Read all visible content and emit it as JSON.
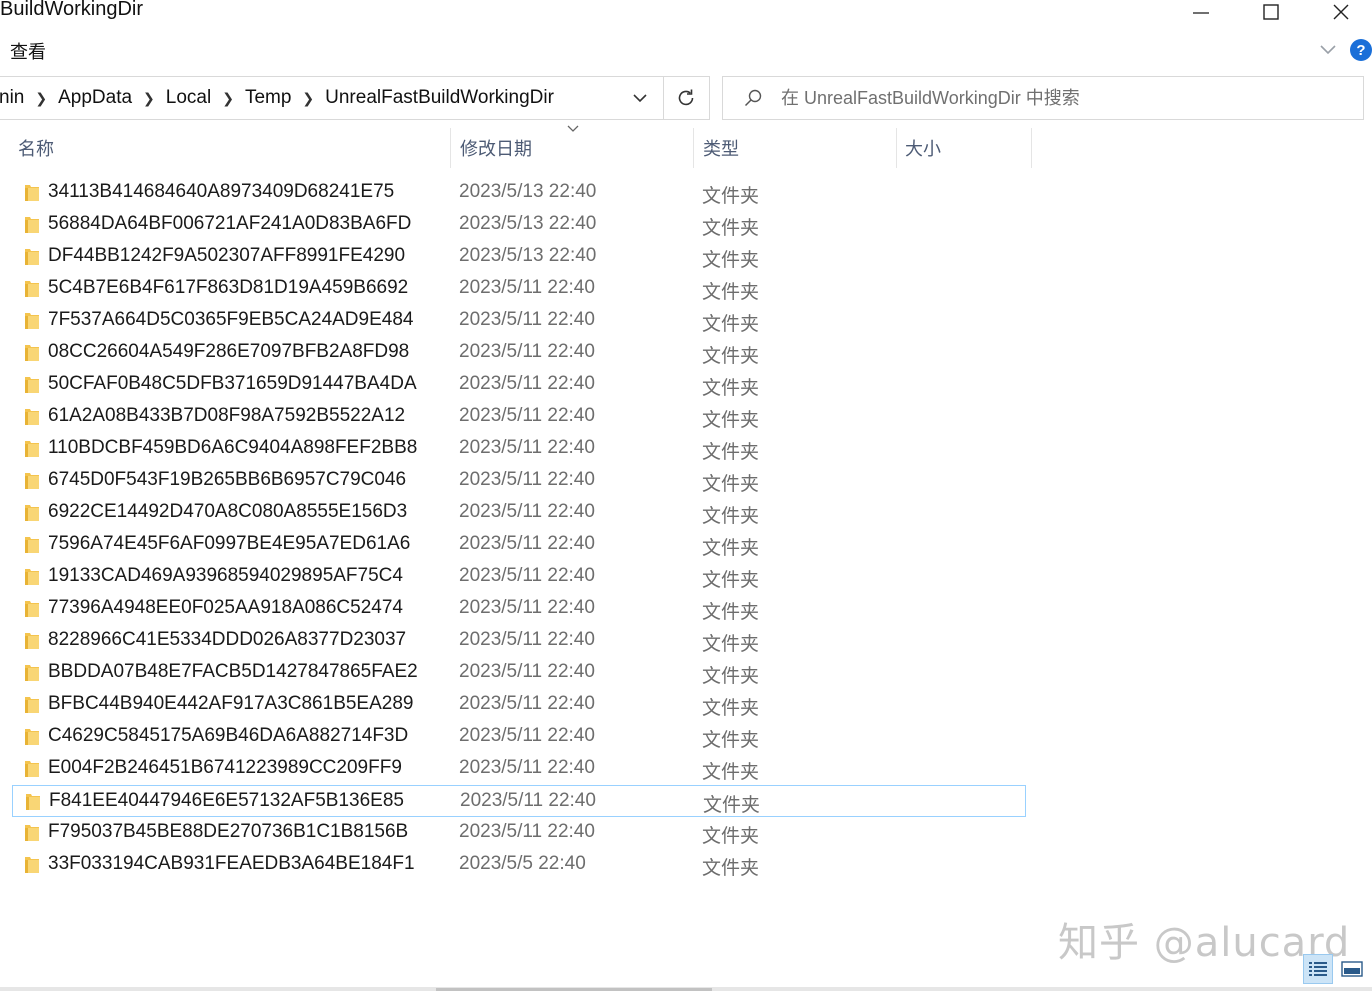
{
  "window": {
    "title": "BuildWorkingDir"
  },
  "ribbon": {
    "view_tab": "查看",
    "help_label": "?"
  },
  "address_bar": {
    "crumbs": [
      "nin",
      "AppData",
      "Local",
      "Temp",
      "UnrealFastBuildWorkingDir"
    ]
  },
  "search": {
    "placeholder": "在 UnrealFastBuildWorkingDir 中搜索"
  },
  "columns": {
    "name": "名称",
    "date": "修改日期",
    "type": "类型",
    "size": "大小"
  },
  "files": [
    {
      "name": "34113B414684640A8973409D68241E75",
      "date": "2023/5/13 22:40",
      "type": "文件夹"
    },
    {
      "name": "56884DA64BF006721AF241A0D83BA6FD",
      "date": "2023/5/13 22:40",
      "type": "文件夹"
    },
    {
      "name": "DF44BB1242F9A502307AFF8991FE4290",
      "date": "2023/5/13 22:40",
      "type": "文件夹"
    },
    {
      "name": "5C4B7E6B4F617F863D81D19A459B6692",
      "date": "2023/5/11 22:40",
      "type": "文件夹"
    },
    {
      "name": "7F537A664D5C0365F9EB5CA24AD9E484",
      "date": "2023/5/11 22:40",
      "type": "文件夹"
    },
    {
      "name": "08CC26604A549F286E7097BFB2A8FD98",
      "date": "2023/5/11 22:40",
      "type": "文件夹"
    },
    {
      "name": "50CFAF0B48C5DFB371659D91447BA4DA",
      "date": "2023/5/11 22:40",
      "type": "文件夹"
    },
    {
      "name": "61A2A08B433B7D08F98A7592B5522A12",
      "date": "2023/5/11 22:40",
      "type": "文件夹"
    },
    {
      "name": "110BDCBF459BD6A6C9404A898FEF2BB8",
      "date": "2023/5/11 22:40",
      "type": "文件夹"
    },
    {
      "name": "6745D0F543F19B265BB6B6957C79C046",
      "date": "2023/5/11 22:40",
      "type": "文件夹"
    },
    {
      "name": "6922CE14492D470A8C080A8555E156D3",
      "date": "2023/5/11 22:40",
      "type": "文件夹"
    },
    {
      "name": "7596A74E45F6AF0997BE4E95A7ED61A6",
      "date": "2023/5/11 22:40",
      "type": "文件夹"
    },
    {
      "name": "19133CAD469A93968594029895AF75C4",
      "date": "2023/5/11 22:40",
      "type": "文件夹"
    },
    {
      "name": "77396A4948EE0F025AA918A086C52474",
      "date": "2023/5/11 22:40",
      "type": "文件夹"
    },
    {
      "name": "8228966C41E5334DDD026A8377D23037",
      "date": "2023/5/11 22:40",
      "type": "文件夹"
    },
    {
      "name": "BBDDA07B48E7FACB5D1427847865FAE2",
      "date": "2023/5/11 22:40",
      "type": "文件夹"
    },
    {
      "name": "BFBC44B940E442AF917A3C861B5EA289",
      "date": "2023/5/11 22:40",
      "type": "文件夹"
    },
    {
      "name": "C4629C5845175A69B46DA6A882714F3D",
      "date": "2023/5/11 22:40",
      "type": "文件夹"
    },
    {
      "name": "E004F2B246451B6741223989CC209FF9",
      "date": "2023/5/11 22:40",
      "type": "文件夹"
    },
    {
      "name": "F841EE40447946E6E57132AF5B136E85",
      "date": "2023/5/11 22:40",
      "type": "文件夹",
      "selected": true
    },
    {
      "name": "F795037B45BE88DE270736B1C1B8156B",
      "date": "2023/5/11 22:40",
      "type": "文件夹"
    },
    {
      "name": "33F033194CAB931FEAEDB3A64BE184F1",
      "date": "2023/5/5 22:40",
      "type": "文件夹"
    }
  ],
  "watermark": "知乎 @alucard",
  "colors": {
    "folder": "#f4c44e",
    "selection_border": "#99d1ff",
    "header_text": "#4d5b75",
    "help_blue": "#1a6fd8"
  },
  "icons": {
    "folder": "folder-icon",
    "search": "search-icon",
    "refresh": "refresh-icon",
    "minimize": "minimize-icon",
    "maximize": "maximize-icon",
    "close": "close-icon"
  }
}
